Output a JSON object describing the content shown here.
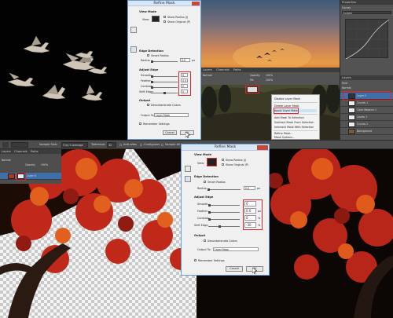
{
  "small_dialog": {
    "title": "Refine Mask",
    "view_mode": {
      "heading": "View Mode",
      "view_label": "View:",
      "show_radius": "Show Radius (J)",
      "show_original": "Show Original (P)"
    },
    "edge_detection": {
      "heading": "Edge Detection",
      "smart_radius": "Smart Radius",
      "radius_label": "Radius:",
      "radius_value": "0.0",
      "radius_unit": "px"
    },
    "adjust_edge": {
      "heading": "Adjust Edge",
      "smooth_label": "Smooth:",
      "smooth_value": "0",
      "feather_label": "Feather:",
      "feather_value": "0.0",
      "contrast_label": "Contrast:",
      "contrast_value": "0",
      "shift_label": "Shift Edge:",
      "shift_value": "0"
    },
    "output": {
      "heading": "Output",
      "decontaminate": "Decontaminate Colors",
      "output_to_label": "Output To:",
      "output_to_value": "Layer Mask"
    },
    "remember": "Remember Settings",
    "cancel": "Cancel",
    "ok": "OK"
  },
  "big_dialog": {
    "title": "Refine Mask",
    "view_mode": {
      "heading": "View Mode",
      "view_label": "View:",
      "show_radius": "Show Radius (J)",
      "show_original": "Show Original (P)"
    },
    "edge_detection": {
      "heading": "Edge Detection",
      "smart_radius": "Smart Radius",
      "radius_label": "Radius:",
      "radius_value": "0.0",
      "radius_unit": "px"
    },
    "adjust_edge": {
      "heading": "Adjust Edge",
      "smooth_label": "Smooth:",
      "smooth_value": "0",
      "feather_label": "Feather:",
      "feather_value": "0.0",
      "feather_unit": "px",
      "contrast_label": "Contrast:",
      "contrast_value": "0",
      "contrast_unit": "%",
      "shift_label": "Shift Edge:",
      "shift_value": "-30",
      "shift_unit": "%"
    },
    "output": {
      "heading": "Output",
      "decontaminate": "Decontaminate Colors",
      "output_to_label": "Output To:",
      "output_to_value": "Layer Mask"
    },
    "remember": "Remember Settings",
    "cancel": "Cancel",
    "ok": "OK"
  },
  "context_menu": {
    "items": [
      "Disable Layer Mask",
      "Delete Layer Mask",
      "Apply Layer Mask",
      "Add Mask To Selection",
      "Subtract Mask From Selection",
      "Intersect Mask With Selection",
      "Refine Mask...",
      "Mask Options..."
    ]
  },
  "options_bar": {
    "sample_size_label": "Sample Size:",
    "sample_size_value": "5 by 5 Average",
    "tolerance_label": "Tolerance:",
    "tolerance_value": "32",
    "anti_alias": "Anti-alias",
    "contiguous": "Contiguous",
    "sample_all": "Sample All Layers"
  },
  "right_panel": {
    "properties_title": "Properties",
    "curves_label": "Curves",
    "preset_label": "Custom",
    "layers_tab": "Layers",
    "channels_tab": "Channels",
    "paths_tab": "Paths",
    "kind_label": "Kind",
    "normal_label": "Normal",
    "opacity_label": "Opacity:",
    "opacity_value": "100%",
    "fill_label": "Fill:",
    "fill_value": "100%",
    "layers": [
      "Layer 1",
      "Curves 1",
      "Color Balance 1",
      "Levels 1",
      "Curves 2",
      "Background"
    ]
  },
  "bottom_layers": {
    "tabs": [
      "Layers",
      "Channels",
      "Paths"
    ],
    "normal_label": "Normal",
    "opacity_label": "Opacity:",
    "opacity_value": "100%",
    "layer_name": "Layer 0"
  },
  "colors": {
    "highlight_red": "#e0222a",
    "dialog_bg": "#f0f0f0",
    "ps_panel": "#535353",
    "ps_dark": "#2f2f2f"
  }
}
